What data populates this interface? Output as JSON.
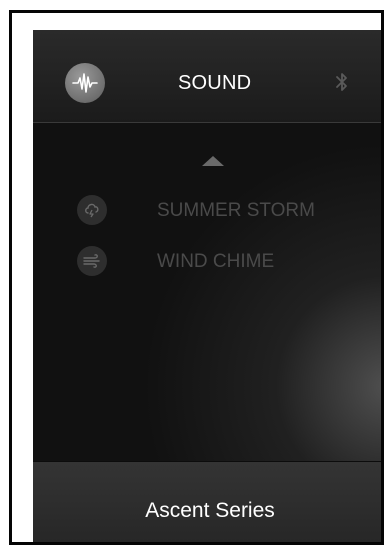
{
  "header": {
    "title": "SOUND",
    "left_icon": "sound-wave-icon",
    "right_icon": "bluetooth-icon"
  },
  "list": {
    "scroll_up_icon": "up-arrow-icon",
    "items": [
      {
        "label": "SUMMER STORM",
        "icon": "storm-cloud-icon"
      },
      {
        "label": "WIND CHIME",
        "icon": "wind-icon"
      }
    ]
  },
  "footer": {
    "label": "Ascent Series"
  },
  "colors": {
    "screen_background": "#0c0c0c",
    "header_background": "#222222",
    "footer_background": "#2d2d2d",
    "inactive_text": "#4a4a4a",
    "active_text": "#ffffff"
  }
}
